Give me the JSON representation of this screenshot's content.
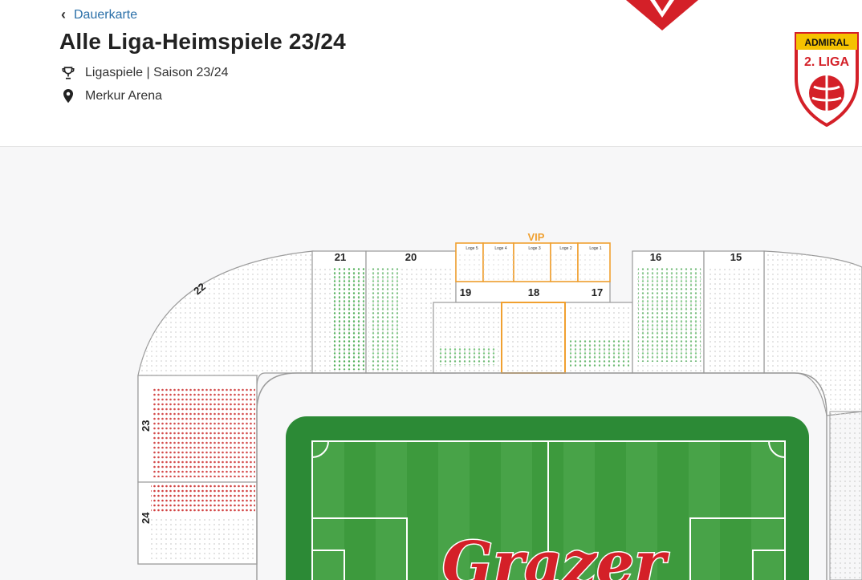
{
  "header": {
    "back_label": "Dauerkarte",
    "title": "Alle Liga-Heimspiele 23/24",
    "competition": "Ligaspiele | Saison 23/24",
    "venue": "Merkur Arena"
  },
  "league_logo": {
    "brand": "ADMIRAL",
    "league": "2. LIGA"
  },
  "stadium": {
    "sectors_top": [
      "21",
      "20",
      "19",
      "18",
      "17",
      "16",
      "15"
    ],
    "sectors_side": [
      "22",
      "23",
      "24"
    ],
    "vip": {
      "label": "VIP",
      "loges": [
        "Loge 5",
        "Loge 4",
        "Loge 3",
        "Loge 2",
        "Loge 1"
      ]
    },
    "pitch_text": "Grazer"
  },
  "colors": {
    "accent_link": "#2a6fa8",
    "available_seat": "#1f9e2a",
    "taken_seat": "#cc2b2b",
    "vip": "#f0a030",
    "pitch": "#3d9a3d"
  }
}
